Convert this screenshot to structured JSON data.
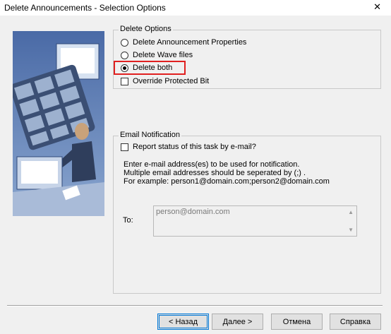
{
  "window": {
    "title": "Delete Announcements - Selection Options",
    "close_glyph": "✕"
  },
  "delete_options": {
    "legend": "Delete Options",
    "items": [
      {
        "label": "Delete Announcement Properties",
        "selected": false
      },
      {
        "label": "Delete Wave files",
        "selected": false
      },
      {
        "label": "Delete both",
        "selected": true
      }
    ],
    "override_label": "Override Protected Bit",
    "override_checked": false
  },
  "email": {
    "legend": "Email Notification",
    "report_label": "Report status of this task by e-mail?",
    "report_checked": false,
    "info_line1": "Enter e-mail address(es) to be used for notification.",
    "info_line2": "Multiple email addresses should be seperated by (;) .",
    "info_line3": "For example: person1@domain.com;person2@domain.com",
    "to_label": "To:",
    "to_value": "person@domain.com"
  },
  "buttons": {
    "back": "< Назад",
    "next": "Далее >",
    "cancel": "Отмена",
    "help": "Справка"
  },
  "illustration": {
    "keys": [
      "1",
      "4",
      "7",
      "Oper",
      "2",
      "5",
      "8",
      "0",
      "3",
      "6",
      "9",
      "#"
    ]
  }
}
